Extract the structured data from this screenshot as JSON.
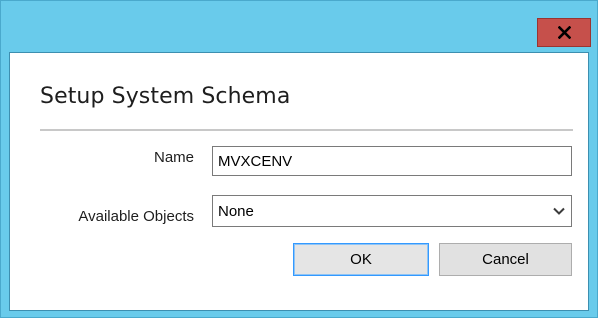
{
  "window": {
    "close_label": "×"
  },
  "dialog": {
    "title": "Setup System Schema"
  },
  "form": {
    "name_label": "Name",
    "name_value": "MVXCENV",
    "objects_label": "Available Objects",
    "objects_selected": "None"
  },
  "buttons": {
    "ok_label": "OK",
    "cancel_label": "Cancel"
  },
  "colors": {
    "frame": "#69cbeb",
    "close_button": "#c6504b",
    "default_button_border": "#3399ff"
  },
  "icons": {
    "close": "close-icon",
    "dropdown": "chevron-down-icon"
  }
}
